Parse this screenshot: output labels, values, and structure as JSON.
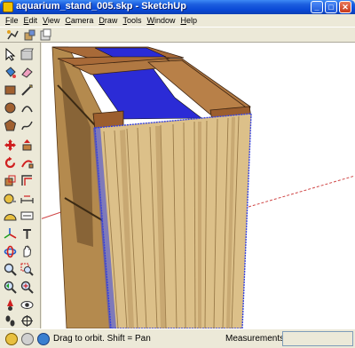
{
  "window": {
    "title": "aquarium_stand_005.skp - SketchUp",
    "minimize_glyph": "_",
    "maximize_glyph": "□",
    "close_glyph": "✕"
  },
  "menu": [
    "File",
    "Edit",
    "View",
    "Camera",
    "Draw",
    "Tools",
    "Window",
    "Help"
  ],
  "statusbar": {
    "hint": "Drag to orbit.  Shift = Pan",
    "measurements_label": "Measurements",
    "measurements_value": ""
  },
  "colors": {
    "wood_panel": "#dcc089",
    "wood_frame": "#9c5e2e",
    "glass_blue": "#2b2bd6",
    "selection_blue": "#3340e0",
    "axis_red": "#d04848"
  },
  "tools": [
    "select",
    "make-component",
    "paint-bucket",
    "eraser",
    "rectangle",
    "line",
    "circle",
    "arc",
    "polygon",
    "freehand",
    "move",
    "push-pull",
    "rotate",
    "follow-me",
    "scale",
    "offset",
    "tape-measure",
    "dimension",
    "protractor",
    "text",
    "axes",
    "3d-text",
    "orbit",
    "pan",
    "zoom",
    "zoom-window",
    "zoom-previous",
    "zoom-extents",
    "position-camera",
    "walk",
    "look-around",
    "section-plane"
  ]
}
